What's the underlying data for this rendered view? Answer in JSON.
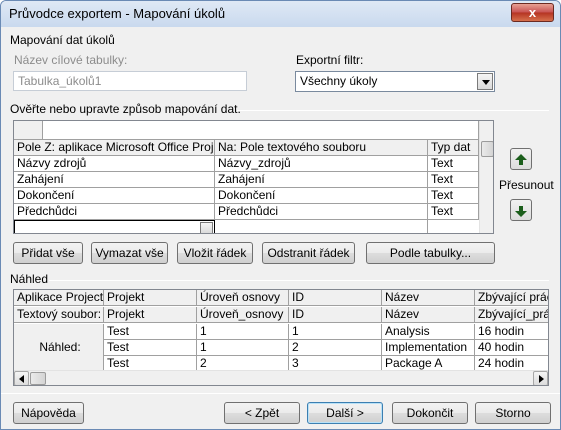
{
  "window": {
    "title": "Průvodce exportem - Mapování úkolů",
    "close_glyph": "x"
  },
  "mapping": {
    "section_label": "Mapování dat úkolů",
    "dest_table_label": "Název cílové tabulky:",
    "dest_table_value": "Tabulka_úkolů1",
    "filter_label": "Exportní filtr:",
    "filter_value": "Všechny úkoly",
    "instructions": "Ověřte nebo upravte způsob mapování dat."
  },
  "map_grid": {
    "headers": [
      "Pole Z: aplikace Microsoft Office Project",
      "Na:  Pole textového souboru",
      "Typ dat"
    ],
    "rows": [
      [
        "Názvy zdrojů",
        "Názvy_zdrojů",
        "Text"
      ],
      [
        "Zahájení",
        "Zahájení",
        "Text"
      ],
      [
        "Dokončení",
        "Dokončení",
        "Text"
      ],
      [
        "Předchůdci",
        "Předchůdci",
        "Text"
      ]
    ]
  },
  "move": {
    "label": "Přesunout"
  },
  "buttons": {
    "add_all": "Přidat vše",
    "clear_all": "Vymazat vše",
    "insert_row": "Vložit řádek",
    "delete_row": "Odstranit řádek",
    "by_table": "Podle tabulky..."
  },
  "preview": {
    "section_label": "Náhled",
    "row_labels": [
      "Aplikace Project:",
      "Textový soubor:",
      "Náhled:"
    ],
    "project_fields": [
      "Projekt",
      "Úroveň osnovy",
      "ID",
      "Název",
      "Zbývající práce"
    ],
    "text_fields": [
      "Projekt",
      "Úroveň_osnovy",
      "ID",
      "Název",
      "Zbývající_práce"
    ],
    "data": [
      [
        "Test",
        "1",
        "1",
        "Analysis",
        "16 hodin"
      ],
      [
        "Test",
        "1",
        "2",
        "Implementation",
        "40 hodin"
      ],
      [
        "Test",
        "2",
        "3",
        "Package A",
        "24 hodin"
      ]
    ]
  },
  "footer": {
    "help": "Nápověda",
    "back": "< Zpět",
    "next": "Další >",
    "finish": "Dokončit",
    "cancel": "Storno"
  }
}
